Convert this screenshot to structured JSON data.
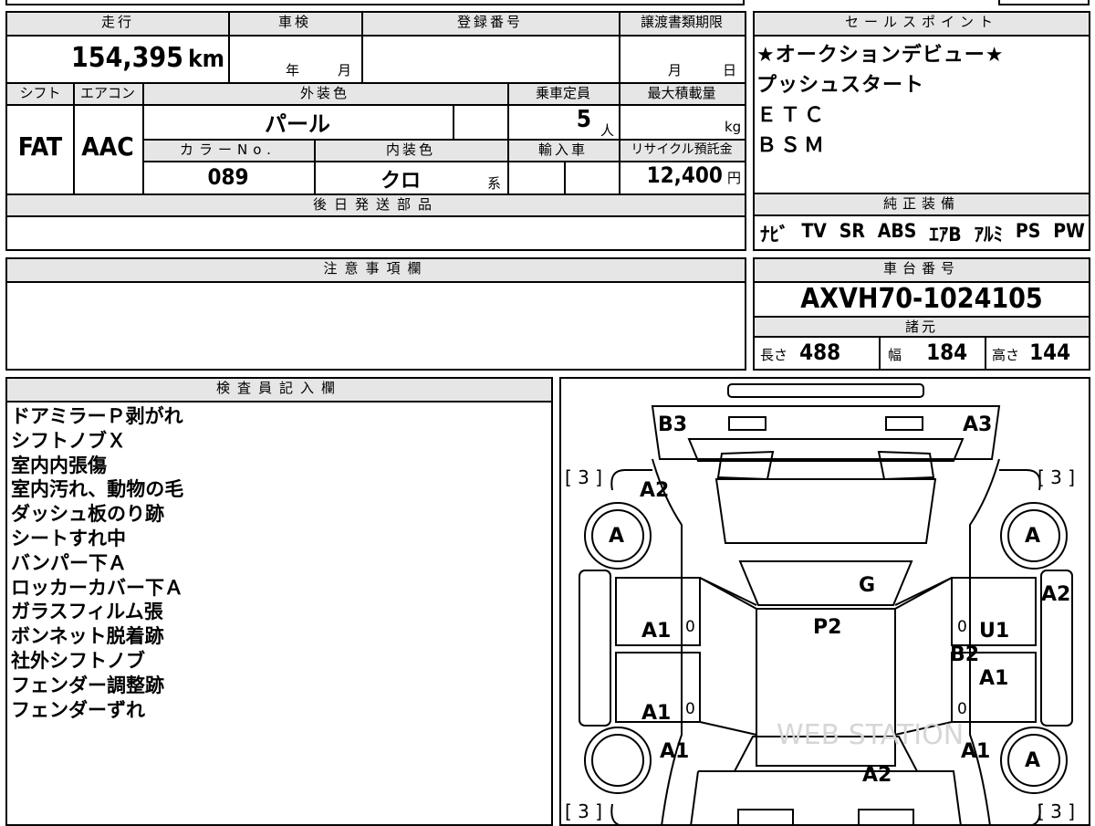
{
  "mileage": {
    "label": "走行",
    "value": "154,395",
    "unit": "km"
  },
  "shaken": {
    "label": "車検",
    "year_unit": "年",
    "month_unit": "月"
  },
  "registration": {
    "label": "登録番号"
  },
  "transfer_deadline": {
    "label": "譲渡書類期限",
    "month_unit": "月",
    "day_unit": "日"
  },
  "shift": {
    "label": "シフト",
    "value": "FAT"
  },
  "aircon": {
    "label": "エアコン",
    "value": "AAC"
  },
  "exterior_color": {
    "label": "外装色",
    "value": "パール"
  },
  "capacity": {
    "label": "乗車定員",
    "value": "5",
    "unit": "人"
  },
  "max_load": {
    "label": "最大積載量",
    "unit": "kg"
  },
  "color_no": {
    "label": "カラーNo.",
    "value": "089"
  },
  "interior_color": {
    "label": "内装色",
    "value": "クロ",
    "unit": "系"
  },
  "import": {
    "label": "輸入車"
  },
  "recycle": {
    "label": "リサイクル預託金",
    "value": "12,400",
    "unit": "円"
  },
  "later_parts": {
    "label": "後日発送部品"
  },
  "notes_header": {
    "label": "注意事項欄"
  },
  "sales_points": {
    "label": "セールスポイント",
    "lines": [
      "★オークションデビュー★",
      "プッシュスタート",
      "ＥＴＣ",
      "ＢＳＭ"
    ]
  },
  "equipment": {
    "label": "純正装備",
    "items": [
      "ﾅﾋﾞ",
      "TV",
      "SR",
      "ABS",
      "ｴｱB",
      "ｱﾙﾐ",
      "PS",
      "PW"
    ]
  },
  "chassis": {
    "label": "車台番号",
    "value": "AXVH70-1024105"
  },
  "specs": {
    "label": "諸元",
    "length_label": "長さ",
    "length": "488",
    "width_label": "幅",
    "width": "184",
    "height_label": "高さ",
    "height": "144"
  },
  "inspector": {
    "label": "検査員記入欄",
    "notes": [
      "ドアミラーＰ剥がれ",
      "シフトノブＸ",
      "室内内張傷",
      "室内汚れ、動物の毛",
      "ダッシュ板のり跡",
      "シートすれ中",
      "バンパー下Ａ",
      "ロッカーカバー下Ａ",
      "ガラスフィルム張",
      "ボンネット脱着跡",
      "社外シフトノブ",
      "フェンダー調整跡",
      "フェンダーずれ"
    ]
  },
  "diagram": {
    "labels": {
      "b3": "B3",
      "a3": "A3",
      "a2_front_left": "A2",
      "g": "G",
      "a2_right": "A2",
      "a1_left_upper": "A1",
      "p2": "P2",
      "u1": "U1",
      "b2": "B2",
      "a1_right_upper": "A1",
      "a1_left_lower": "A1",
      "a1_rear_left": "A1",
      "a1_rear_right": "A1",
      "a2_rear": "A2",
      "tire_fl": "A",
      "tire_fr": "A",
      "tire_rr": "A",
      "tread_fl": "[ 3 ]",
      "tread_fr": "[ 3 ]",
      "tread_rl": "[ 3 ]",
      "tread_rr": "[ 3 ]",
      "zero_1": "0",
      "zero_2": "0",
      "zero_3": "0",
      "zero_4": "0"
    },
    "watermark": "WEB STATION"
  }
}
